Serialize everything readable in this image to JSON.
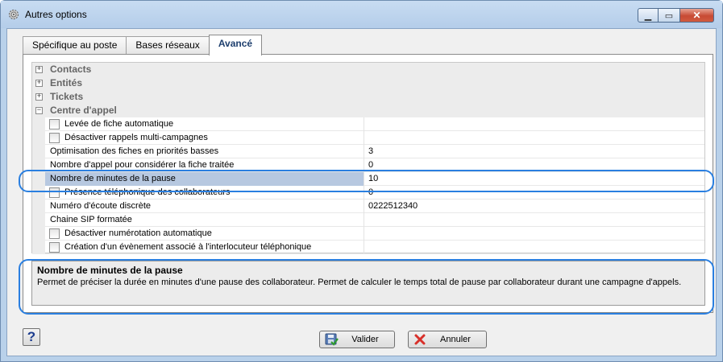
{
  "window": {
    "title": "Autres options"
  },
  "tabs": [
    {
      "label": "Spécifique au poste"
    },
    {
      "label": "Bases réseaux"
    },
    {
      "label": "Avancé"
    }
  ],
  "categories": {
    "contacts": {
      "label": "Contacts",
      "expander": "+"
    },
    "entites": {
      "label": "Entités",
      "expander": "+"
    },
    "tickets": {
      "label": "Tickets",
      "expander": "+"
    },
    "centre": {
      "label": "Centre d'appel",
      "expander": "−"
    }
  },
  "properties": [
    {
      "name": "Levée de fiche automatique",
      "value": ""
    },
    {
      "name": "Désactiver rappels multi-campagnes",
      "value": ""
    },
    {
      "name": "Optimisation des fiches en priorités basses",
      "value": "3"
    },
    {
      "name": "Nombre d'appel pour considérer la fiche traitée",
      "value": "0"
    },
    {
      "name": "Nombre de minutes de la pause",
      "value": "10"
    },
    {
      "name": "Présence téléphonique des collaborateurs",
      "value": "0"
    },
    {
      "name": "Numéro d'écoute discrète",
      "value": "0222512340"
    },
    {
      "name": "Chaine SIP formatée",
      "value": ""
    },
    {
      "name": "Désactiver numérotation automatique",
      "value": ""
    },
    {
      "name": "Création d'un évènement associé à l'interlocuteur téléphonique",
      "value": ""
    }
  ],
  "info": {
    "title": "Nombre de minutes de la pause",
    "description": "Permet de préciser la durée en minutes d'une pause des collaborateur. Permet de calculer le temps total de pause par collaborateur durant une campagne d'appels."
  },
  "buttons": {
    "help": "?",
    "ok": "Valider",
    "cancel": "Annuler"
  },
  "colors": {
    "selection": "#b7c8e0",
    "highlight": "#2a7fe0",
    "active_tab_text": "#1e3f6e"
  }
}
